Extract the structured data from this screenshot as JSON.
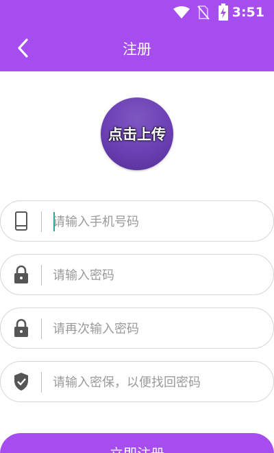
{
  "status_bar": {
    "time": "3:51"
  },
  "header": {
    "title": "注册"
  },
  "avatar": {
    "label": "点击上传"
  },
  "fields": [
    {
      "placeholder": "请输入手机号码",
      "icon": "phone-icon"
    },
    {
      "placeholder": "请输入密码",
      "icon": "lock-icon"
    },
    {
      "placeholder": "请再次输入密码",
      "icon": "lock-icon"
    },
    {
      "placeholder": "请输入密保，以便找回密码",
      "icon": "shield-check-icon"
    }
  ],
  "submit": {
    "label": "立即注册"
  },
  "colors": {
    "accent": "#a64df0",
    "avatar": "#6b3fb3",
    "cursor": "#26a69a"
  }
}
